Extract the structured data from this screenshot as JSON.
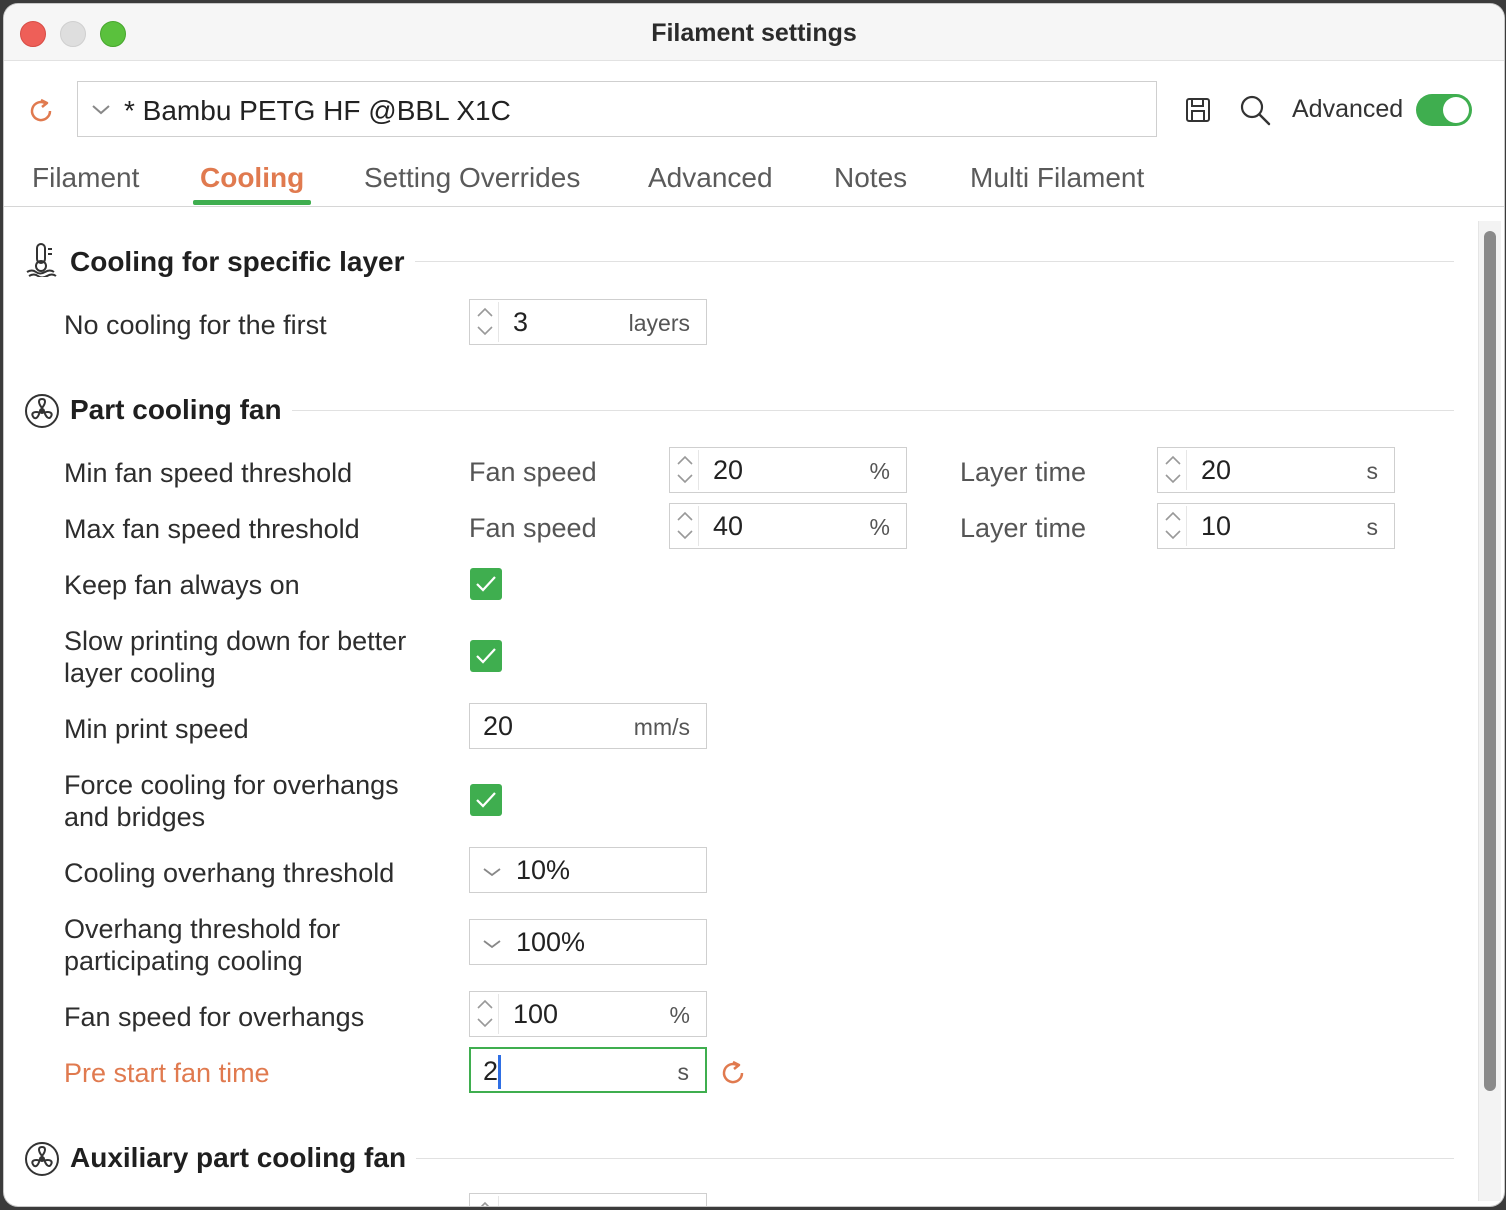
{
  "window": {
    "title": "Filament settings"
  },
  "toolbar": {
    "preset": "* Bambu PETG HF @BBL X1C",
    "advanced_label": "Advanced",
    "advanced_on": true
  },
  "tabs": [
    {
      "label": "Filament",
      "active": false
    },
    {
      "label": "Cooling",
      "active": true
    },
    {
      "label": "Setting Overrides",
      "active": false
    },
    {
      "label": "Advanced",
      "active": false
    },
    {
      "label": "Notes",
      "active": false
    },
    {
      "label": "Multi Filament",
      "active": false
    }
  ],
  "sections": {
    "specific_layer": {
      "title": "Cooling for specific layer",
      "no_cooling": {
        "label": "No cooling for the first",
        "value": "3",
        "unit": "layers"
      }
    },
    "part_fan": {
      "title": "Part cooling fan",
      "min_fan": {
        "label": "Min fan speed threshold",
        "fan_speed_label": "Fan speed",
        "fan_speed": "20",
        "fan_unit": "%",
        "layer_time_label": "Layer time",
        "layer_time": "20",
        "layer_unit": "s"
      },
      "max_fan": {
        "label": "Max fan speed threshold",
        "fan_speed_label": "Fan speed",
        "fan_speed": "40",
        "fan_unit": "%",
        "layer_time_label": "Layer time",
        "layer_time": "10",
        "layer_unit": "s"
      },
      "keep_fan_on": {
        "label": "Keep fan always on",
        "checked": true
      },
      "slow_down": {
        "label_line1": "Slow printing down for better",
        "label_line2": "layer cooling",
        "checked": true
      },
      "min_print_speed": {
        "label": "Min print speed",
        "value": "20",
        "unit": "mm/s"
      },
      "force_cooling": {
        "label_line1": "Force cooling for overhangs",
        "label_line2": "and bridges",
        "checked": true
      },
      "overhang_threshold": {
        "label": "Cooling overhang threshold",
        "value": "10%"
      },
      "participating": {
        "label_line1": "Overhang threshold for",
        "label_line2": "participating cooling",
        "value": "100%"
      },
      "fan_overhangs": {
        "label": "Fan speed for overhangs",
        "value": "100",
        "unit": "%"
      },
      "pre_start": {
        "label": "Pre start fan time",
        "value": "2",
        "unit": "s"
      }
    },
    "aux_fan": {
      "title": "Auxiliary part cooling fan"
    }
  },
  "colors": {
    "accent_orange": "#e07a4f",
    "accent_green": "#3fae4f"
  }
}
